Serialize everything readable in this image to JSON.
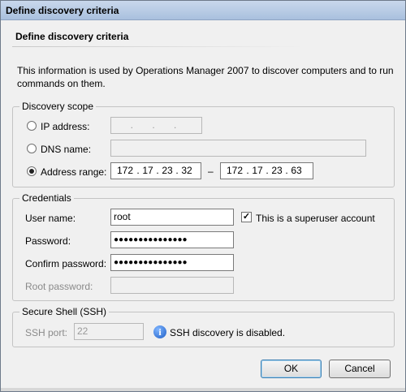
{
  "window": {
    "title": "Define discovery criteria"
  },
  "header": {
    "title": "Define discovery criteria"
  },
  "description": "This information is used by Operations Manager 2007 to discover computers and to run commands on them.",
  "discovery_scope": {
    "label": "Discovery scope",
    "ip_address": {
      "label": "IP address:",
      "selected": false,
      "value": ". . ."
    },
    "dns_name": {
      "label": "DNS name:",
      "selected": false,
      "value": ""
    },
    "address_range": {
      "label": "Address range:",
      "selected": true,
      "start": [
        "172",
        "17",
        "23",
        "32"
      ],
      "separator": "–",
      "end": [
        "172",
        "17",
        "23",
        "63"
      ]
    }
  },
  "credentials": {
    "label": "Credentials",
    "user_name": {
      "label": "User name:",
      "value": "root"
    },
    "superuser": {
      "label": "This is a superuser account",
      "checked": true
    },
    "password": {
      "label": "Password:",
      "value": "●●●●●●●●●●●●●●●"
    },
    "confirm_password": {
      "label": "Confirm password:",
      "value": "●●●●●●●●●●●●●●●"
    },
    "root_password": {
      "label": "Root password:",
      "value": ""
    }
  },
  "ssh": {
    "label": "Secure Shell (SSH)",
    "port_label": "SSH port:",
    "port_value": "22",
    "info_text": "SSH discovery is disabled.",
    "info_icon": "info-icon"
  },
  "buttons": {
    "ok": "OK",
    "cancel": "Cancel"
  }
}
